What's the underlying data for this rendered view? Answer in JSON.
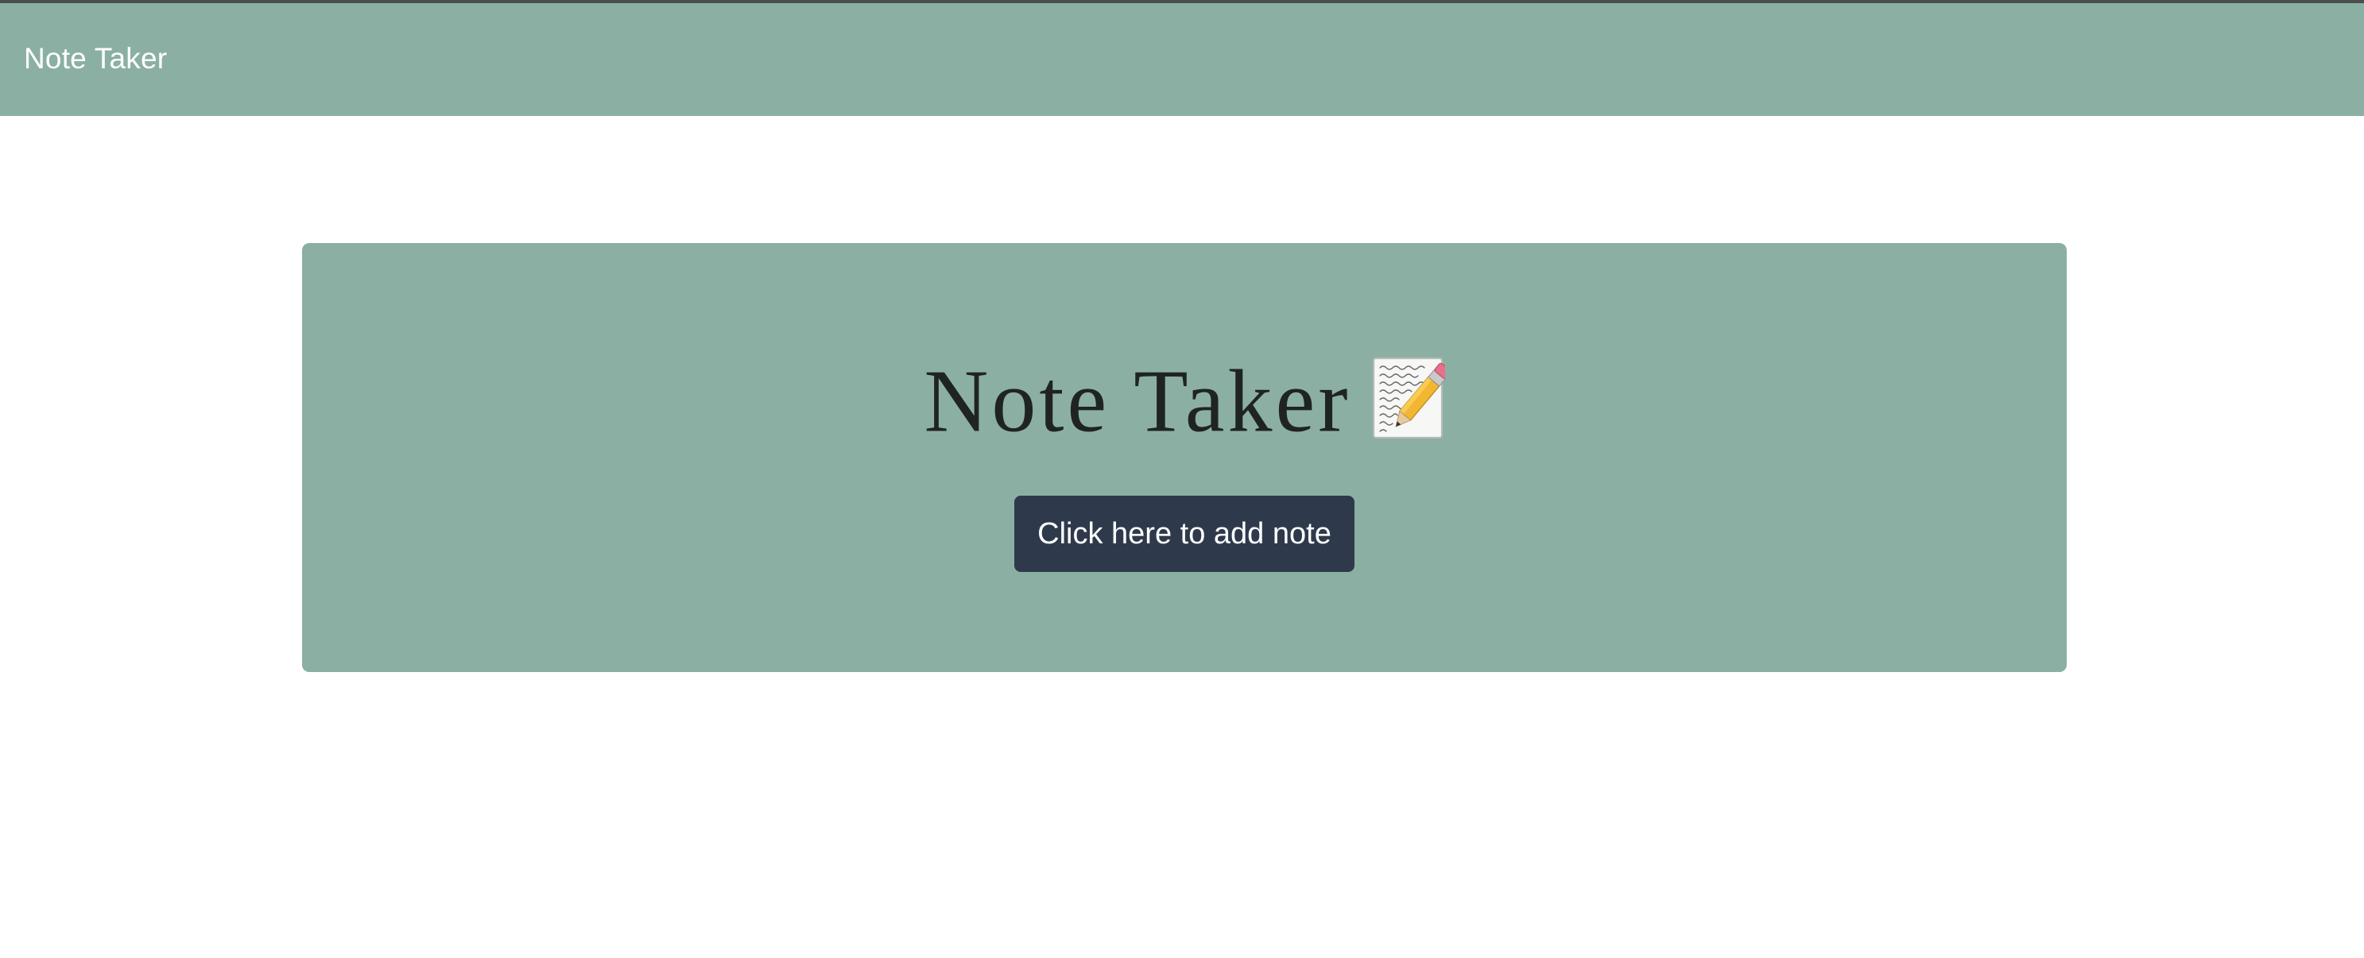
{
  "navbar": {
    "brand": "Note Taker"
  },
  "hero": {
    "title": "Note Taker",
    "icon": "memo-pencil-icon",
    "button_label": "Click here to add note"
  },
  "colors": {
    "accent": "#8bb0a3",
    "button": "#2e3a4c",
    "top_border": "#4a4f4c",
    "title_text": "#1f2422",
    "background": "#ffffff"
  }
}
